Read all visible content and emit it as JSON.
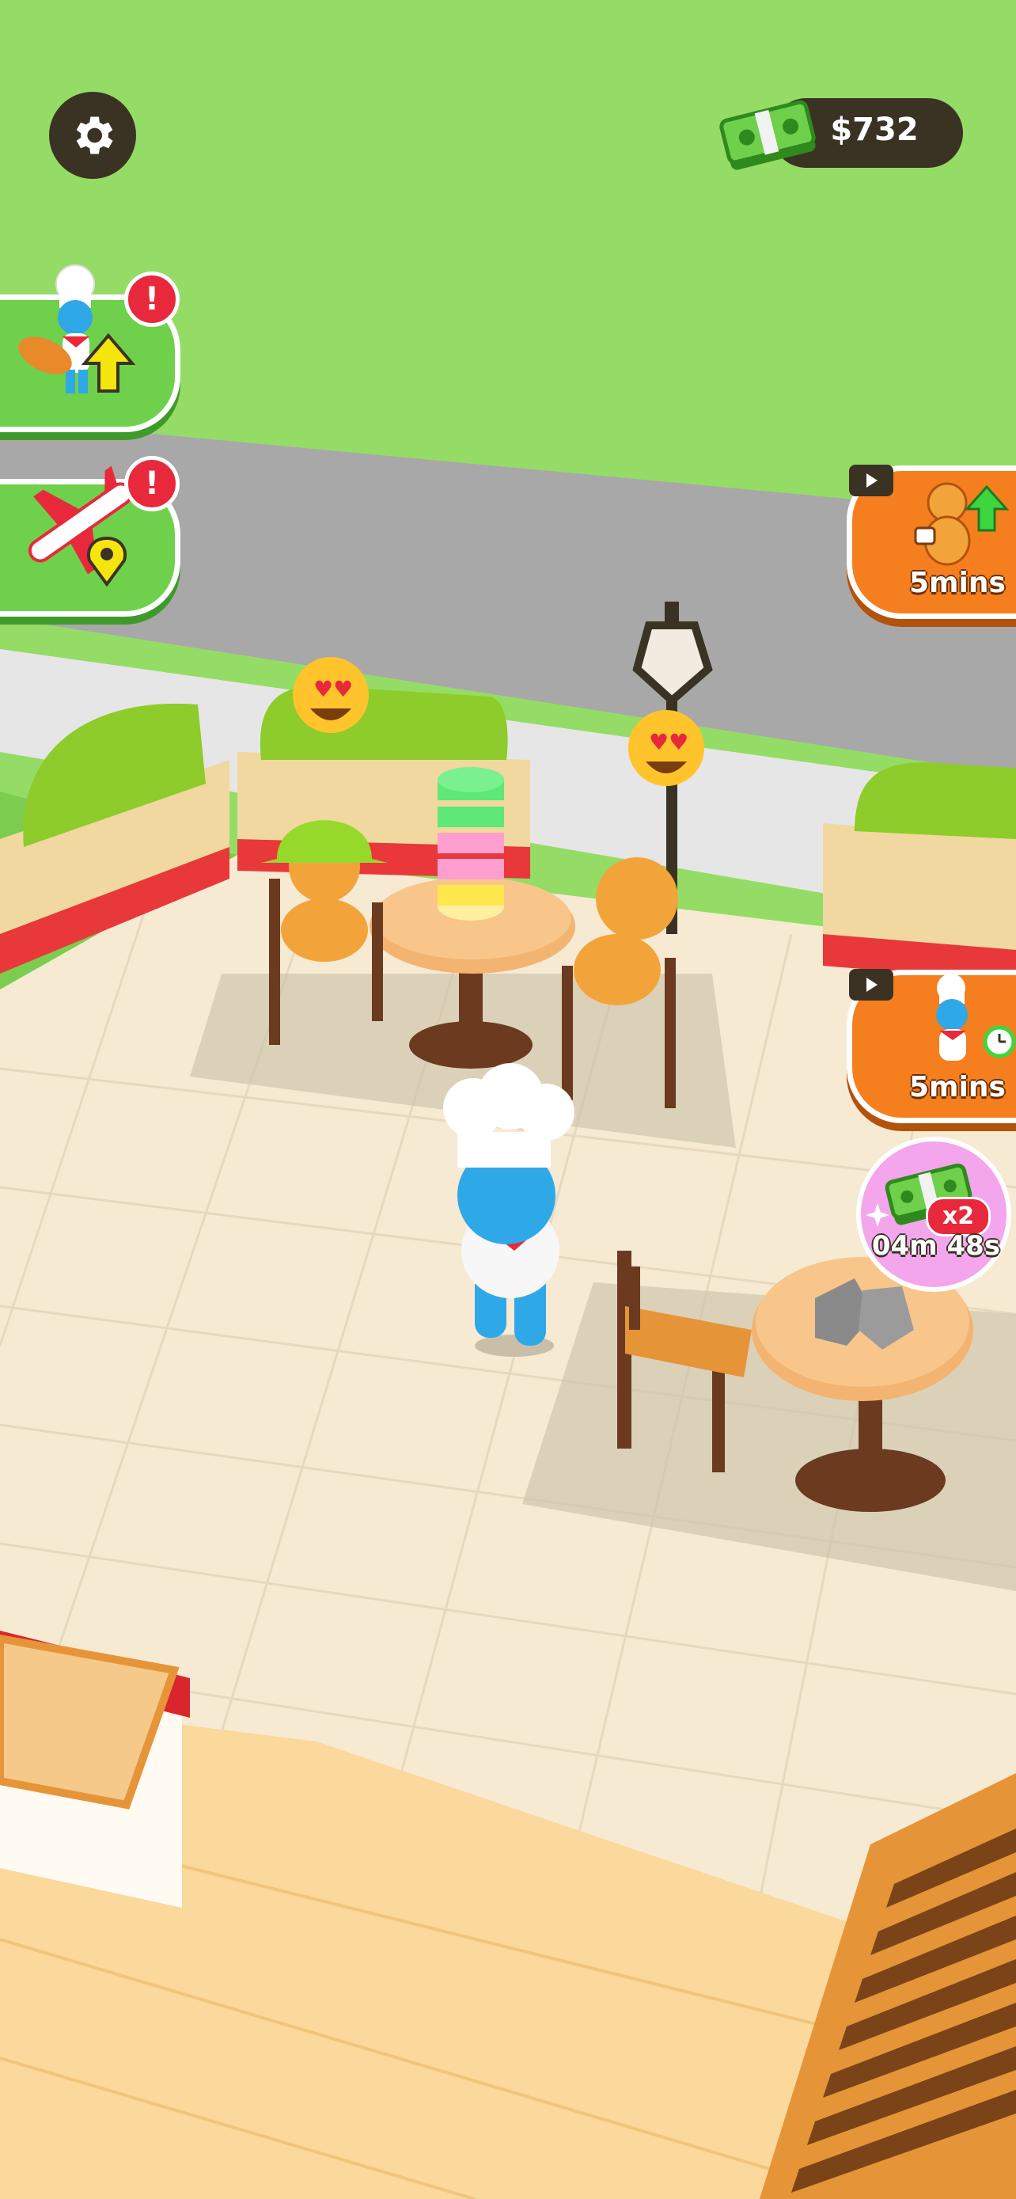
{
  "hud": {
    "money": "$732",
    "settings_icon": "gear-icon",
    "money_icon": "cash-stack-icon"
  },
  "left_panel": [
    {
      "name": "hire-chef-upgrade",
      "icon": "chef-upgrade-icon",
      "badge": "!"
    },
    {
      "name": "travel-location",
      "icon": "airplane-location-icon",
      "badge": "!"
    }
  ],
  "right_panel": [
    {
      "name": "customer-boost",
      "icon": "customer-speed-icon",
      "duration": "5mins"
    },
    {
      "name": "chef-speed-boost",
      "icon": "chef-timer-icon",
      "duration": "5mins"
    }
  ],
  "income_boost": {
    "multiplier": "x2",
    "timer": "04m 48s"
  },
  "colors": {
    "grass": "#95dc66",
    "road": "#a8a8a8",
    "floor": "#f6ead3",
    "orange_button": "#f57f1e",
    "green_button": "#6fd04c",
    "dark_ui": "#3a3324",
    "alert_red": "#e8293b"
  }
}
